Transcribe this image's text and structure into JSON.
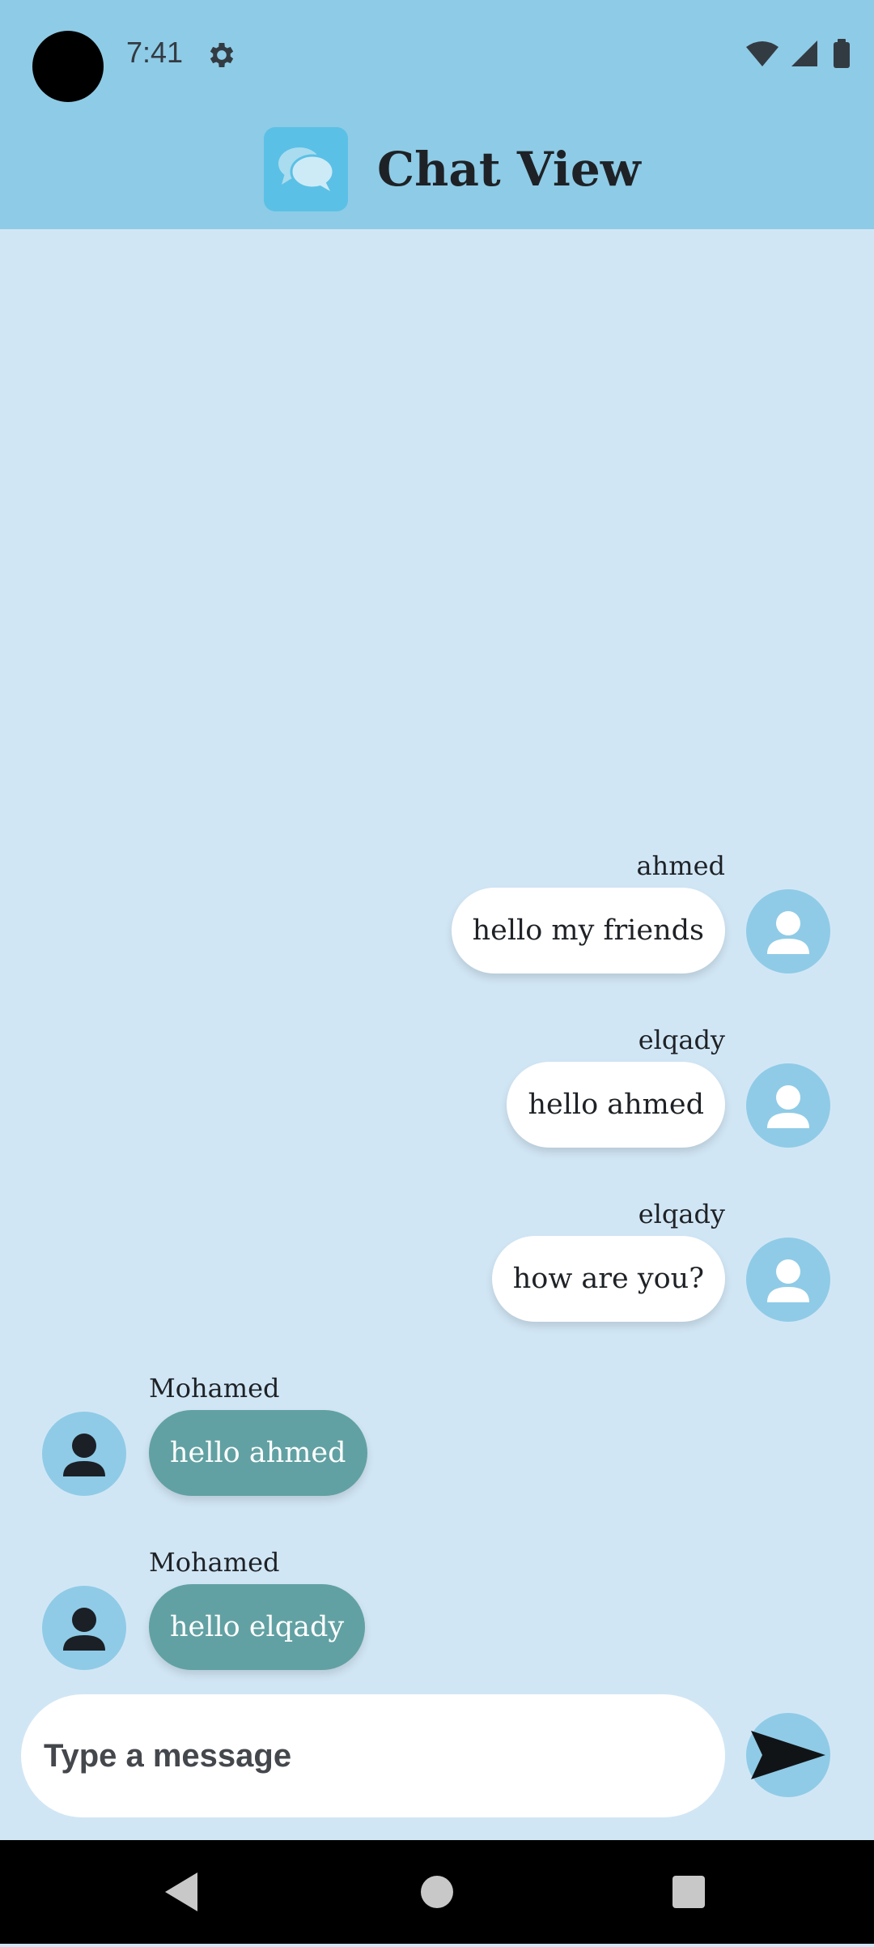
{
  "status_bar": {
    "time": "7:41"
  },
  "app_bar": {
    "title": "Chat View"
  },
  "messages": [
    {
      "sender": "ahmed",
      "text": "hello my friends",
      "direction": "outgoing"
    },
    {
      "sender": "elqady",
      "text": "hello ahmed",
      "direction": "outgoing"
    },
    {
      "sender": "elqady",
      "text": "how are you?",
      "direction": "outgoing"
    },
    {
      "sender": "Mohamed",
      "text": "hello ahmed",
      "direction": "incoming"
    },
    {
      "sender": "Mohamed",
      "text": "hello elqady",
      "direction": "incoming"
    }
  ],
  "composer": {
    "placeholder": "Type a message",
    "value": ""
  },
  "icons": {
    "settings": "gear-icon",
    "wifi": "wifi-icon",
    "signal": "signal-icon",
    "battery": "battery-icon",
    "logo": "chat-bubbles-icon",
    "avatar": "person-icon",
    "send": "send-icon",
    "back": "back-icon",
    "home": "home-icon",
    "recents": "recents-icon"
  },
  "colors": {
    "app_bar": "#8ecbe6",
    "background": "#d1e6f5",
    "outgoing_bubble": "#ffffff",
    "incoming_bubble": "#62a1a3",
    "avatar": "#8fcbe6",
    "logo": "#5bc0e6"
  }
}
